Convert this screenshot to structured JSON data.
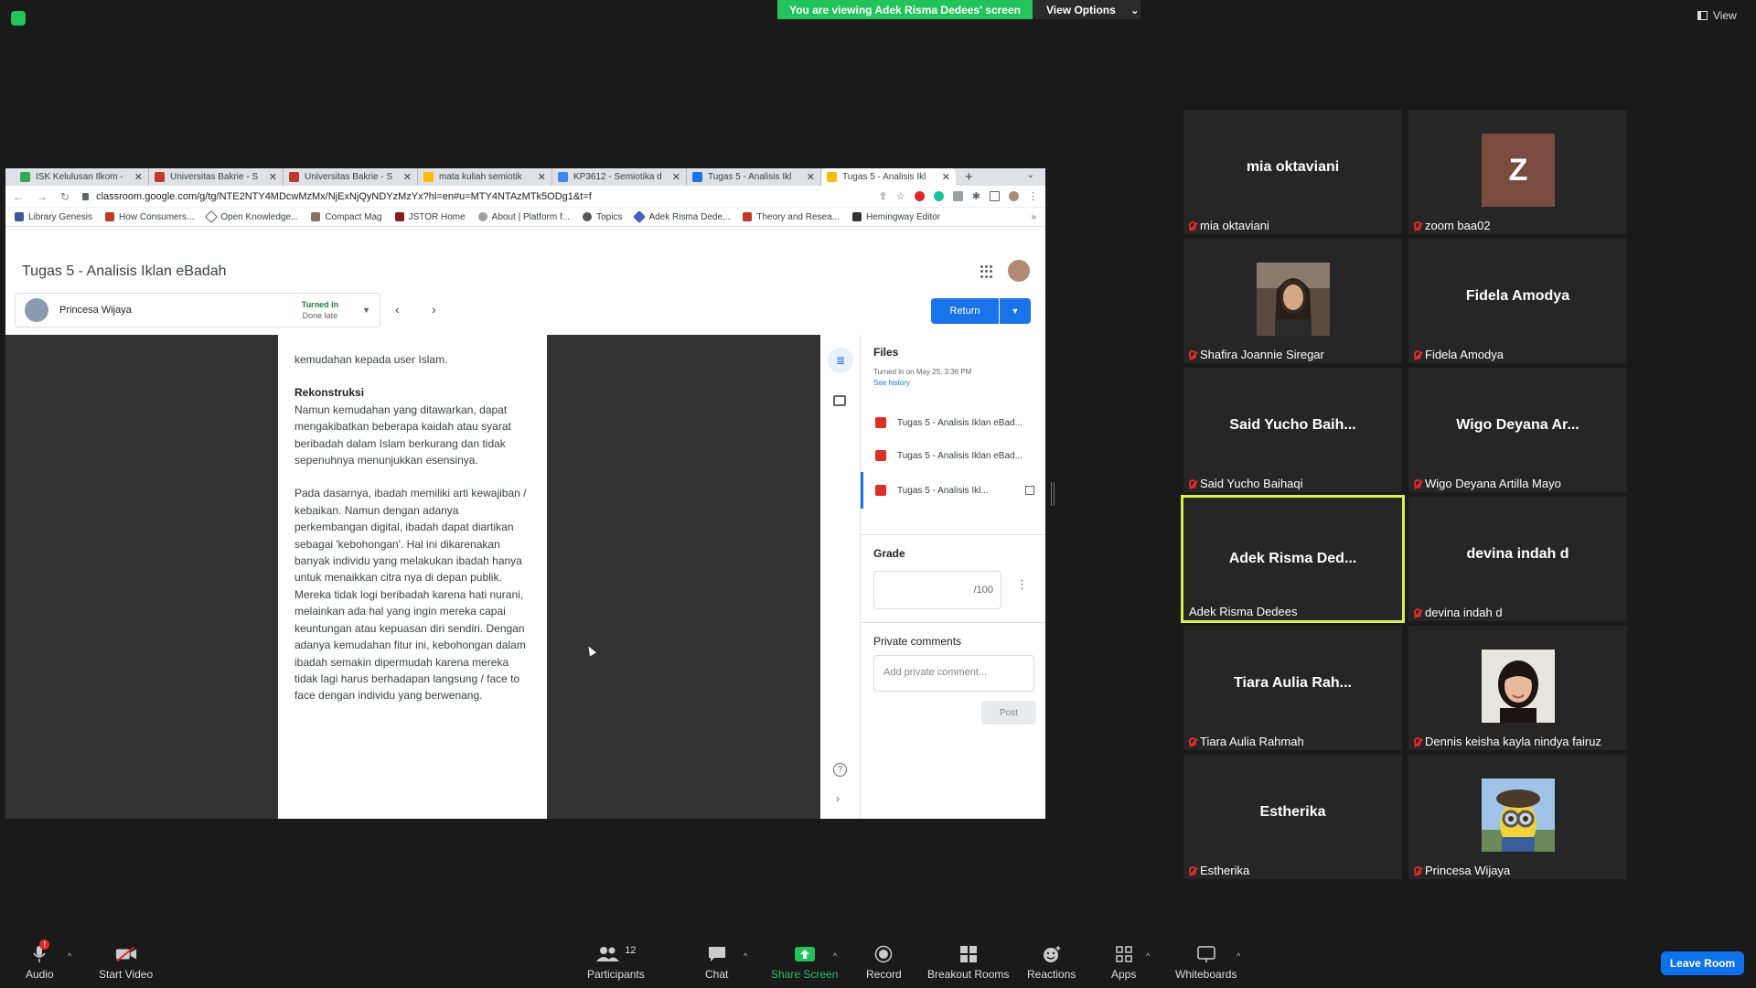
{
  "top": {
    "banner": "You are viewing Adek Risma Dedees' screen",
    "view_options": "View Options",
    "view_label": "View",
    "banner_color": "#23c35c"
  },
  "browser": {
    "tabs": [
      {
        "title": "ISK Kelulusan Ilkom -",
        "icon": "drive-icon",
        "color": "#34a853"
      },
      {
        "title": "Universitas Bakrie - S",
        "icon": "shield-icon",
        "color": "#c0392b"
      },
      {
        "title": "Universitas Bakrie - S",
        "icon": "shield-icon",
        "color": "#c0392b"
      },
      {
        "title": "mata kuliah semiotik",
        "icon": "drive-icon",
        "color": "#fbbc04"
      },
      {
        "title": "KP3612 - Semiotika d",
        "icon": "doc-icon",
        "color": "#4285f4"
      },
      {
        "title": "Tugas 5 - Analisis Ikl",
        "icon": "classroom-icon",
        "color": "#1a73e8"
      },
      {
        "title": "Tugas 5 - Analisis Ikl",
        "icon": "classroom-icon",
        "color": "#fbbc04"
      }
    ],
    "url": "classroom.google.com/g/tg/NTE2NTY4MDcwMzMx/NjExNjQyNDYzMzYx?hl=en#u=MTY4NTAzMTk5ODg1&t=f",
    "bookmarks": [
      "Library Genesis",
      "How Consumers...",
      "Open Knowledge...",
      "Compact Mag",
      "JSTOR Home",
      "About | Platform f...",
      "Topics",
      "Adek Risma Dede...",
      "Theory and Resea...",
      "Hemingway Editor"
    ],
    "bookmarks_more": "»"
  },
  "classroom": {
    "title": "Tugas 5 - Analisis Iklan eBadah",
    "student": "Princesa Wijaya",
    "status": "Turned in",
    "substatus": "Done late",
    "return_label": "Return",
    "files_heading": "Files",
    "turned_in_time": "Turned in on May 25, 3:36 PM",
    "see_history": "See history",
    "files": [
      "Tugas 5 - Analisis Iklan eBad...",
      "Tugas 5 - Analisis Iklan eBad...",
      "Tugas 5 - Analisis Ikl..."
    ],
    "grade_heading": "Grade",
    "grade_denominator": "/100",
    "private_comments": "Private comments",
    "comment_placeholder": "Add private comment...",
    "post_label": "Post"
  },
  "document": {
    "line0": "kemudahan kepada user Islam.",
    "heading": "Rekonstruksi",
    "para1": "Namun kemudahan yang ditawarkan, dapat mengakibatkan beberapa kaidah atau syarat beribadah dalam Islam berkurang dan tidak sepenuhnya menunjukkan esensinya.",
    "para2": "Pada dasarnya, ibadah memiliki arti kewajiban / kebaikan. Namun dengan adanya perkembangan digital, ibadah dapat diartikan sebagai 'kebohongan'. Hal ini dikarenakan banyak individu yang melakukan ibadah hanya untuk menaikkan citra nya di depan publik. Mereka tidak logi beribadah karena hati nurani, melainkan ada hal yang ingin mereka capai keuntungan atau kepuasan diri sendiri. Dengan adanya kemudahan fitur ini, kebohongan dalam ibadah semakin dipermudah karena mereka tidak lagi harus berhadapan langsung / face to face dengan individu yang berwenang."
  },
  "gallery": [
    {
      "display": "mia oktaviani",
      "label": "mia oktaviani",
      "muted": true
    },
    {
      "display": "Z",
      "label": "zoom baa02",
      "muted": true,
      "avatar": "letter"
    },
    {
      "display": "",
      "label": "Shafira Joannie Siregar",
      "muted": true,
      "avatar": "photo"
    },
    {
      "display": "Fidela Amodya",
      "label": "Fidela Amodya",
      "muted": true
    },
    {
      "display": "Said Yucho Baih...",
      "label": "Said Yucho Baihaqi",
      "muted": true
    },
    {
      "display": "Wigo Deyana Ar...",
      "label": "Wigo Deyana Artilla Mayo",
      "muted": true
    },
    {
      "display": "Adek Risma Ded...",
      "label": "Adek Risma Dedees",
      "muted": false,
      "active": true
    },
    {
      "display": "devina indah d",
      "label": "devina indah d",
      "muted": true
    },
    {
      "display": "Tiara Aulia Rah...",
      "label": "Tiara Aulia Rahmah",
      "muted": true
    },
    {
      "display": "",
      "label": "Dennis keisha kayla nindya fairuz",
      "muted": true,
      "avatar": "photo"
    },
    {
      "display": "Estherika",
      "label": "Estherika",
      "muted": true
    },
    {
      "display": "",
      "label": "Princesa Wijaya",
      "muted": true,
      "avatar": "photo"
    }
  ],
  "toolbar": {
    "audio": "Audio",
    "audio_badge": "!",
    "start_video": "Start Video",
    "participants": "Participants",
    "participants_count": "12",
    "chat": "Chat",
    "share_screen": "Share Screen",
    "record": "Record",
    "breakout": "Breakout Rooms",
    "reactions": "Reactions",
    "apps": "Apps",
    "whiteboards": "Whiteboards",
    "leave": "Leave Room",
    "leave_color": "#0e72ed"
  }
}
